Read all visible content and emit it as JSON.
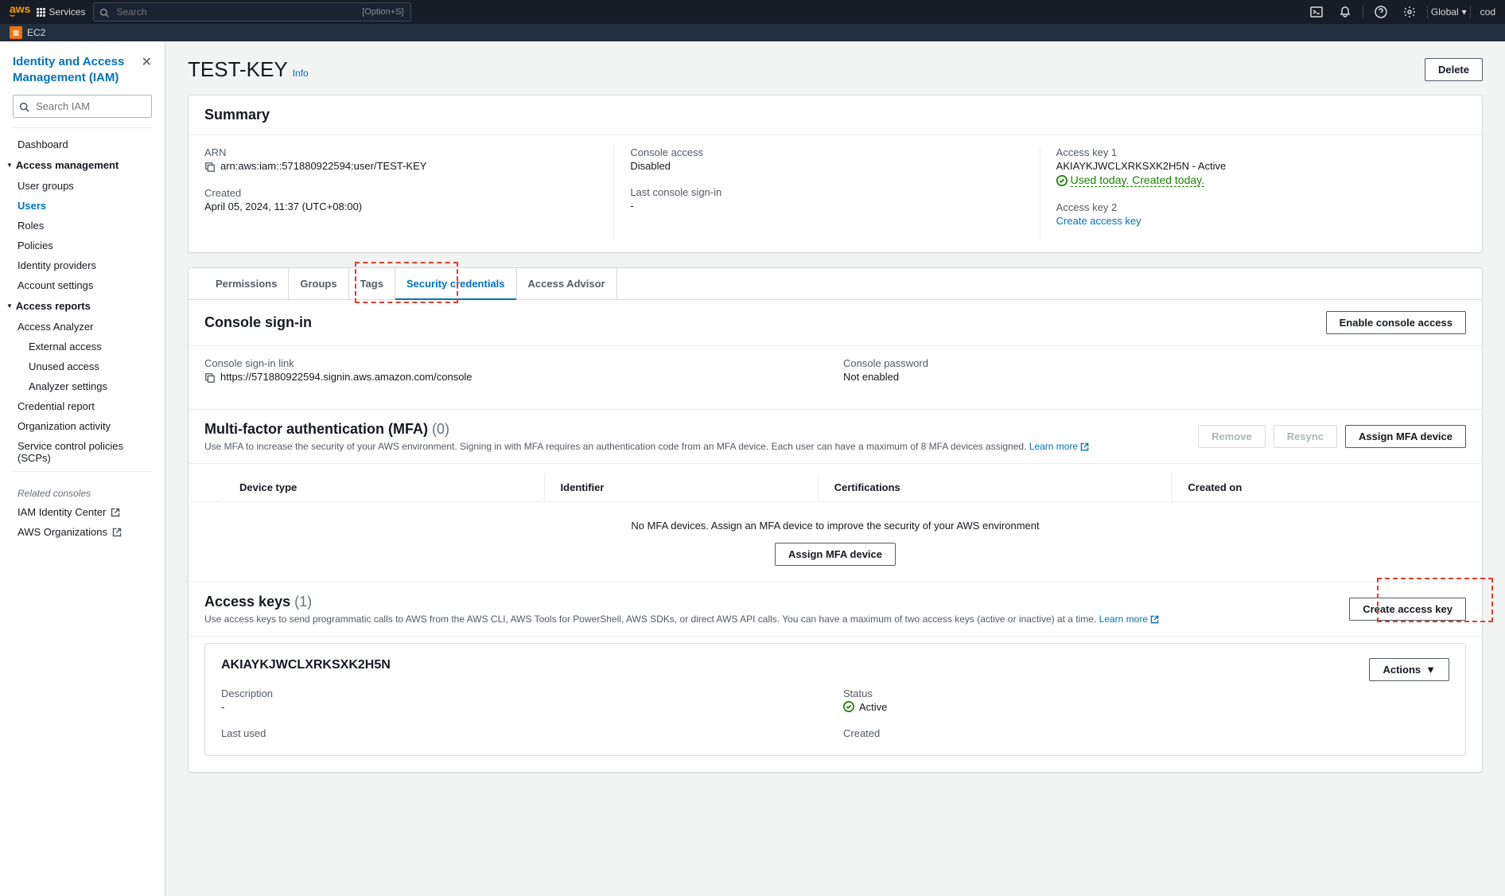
{
  "topnav": {
    "services_label": "Services",
    "search_placeholder": "Search",
    "search_kbd": "[Option+S]",
    "region": "Global",
    "account_fragment": "cod"
  },
  "servicenav": {
    "ec2": "EC2"
  },
  "sidebar": {
    "title": "Identity and Access Management (IAM)",
    "search_placeholder": "Search IAM",
    "dashboard": "Dashboard",
    "section_access_mgmt": "Access management",
    "user_groups": "User groups",
    "users": "Users",
    "roles": "Roles",
    "policies": "Policies",
    "identity_providers": "Identity providers",
    "account_settings": "Account settings",
    "section_access_reports": "Access reports",
    "access_analyzer": "Access Analyzer",
    "external_access": "External access",
    "unused_access": "Unused access",
    "analyzer_settings": "Analyzer settings",
    "credential_report": "Credential report",
    "organization_activity": "Organization activity",
    "scps": "Service control policies (SCPs)",
    "related_header": "Related consoles",
    "iam_identity_center": "IAM Identity Center",
    "aws_organizations": "AWS Organizations"
  },
  "page": {
    "title": "TEST-KEY",
    "info": "Info",
    "delete_btn": "Delete"
  },
  "summary": {
    "header": "Summary",
    "arn_label": "ARN",
    "arn_value": "arn:aws:iam::571880922594:user/TEST-KEY",
    "created_label": "Created",
    "created_value": "April 05, 2024, 11:37 (UTC+08:00)",
    "console_access_label": "Console access",
    "console_access_value": "Disabled",
    "last_signin_label": "Last console sign-in",
    "last_signin_value": "-",
    "key1_label": "Access key 1",
    "key1_value": "AKIAYKJWCLXRKSXK2H5N - Active",
    "key1_status": "Used today. Created today.",
    "key2_label": "Access key 2",
    "key2_link": "Create access key"
  },
  "tabs": {
    "permissions": "Permissions",
    "groups": "Groups",
    "tags": "Tags",
    "security": "Security credentials",
    "advisor": "Access Advisor"
  },
  "console_signin": {
    "header": "Console sign-in",
    "enable_btn": "Enable console access",
    "link_label": "Console sign-in link",
    "link_value": "https://571880922594.signin.aws.amazon.com/console",
    "pwd_label": "Console password",
    "pwd_value": "Not enabled"
  },
  "mfa": {
    "header": "Multi-factor authentication (MFA)",
    "count": "(0)",
    "desc": "Use MFA to increase the security of your AWS environment. Signing in with MFA requires an authentication code from an MFA device. Each user can have a maximum of 8 MFA devices assigned.",
    "learn_more": "Learn more",
    "remove_btn": "Remove",
    "resync_btn": "Resync",
    "assign_btn": "Assign MFA device",
    "col_device": "Device type",
    "col_identifier": "Identifier",
    "col_certs": "Certifications",
    "col_created": "Created on",
    "empty_text": "No MFA devices. Assign an MFA device to improve the security of your AWS environment",
    "empty_btn": "Assign MFA device"
  },
  "access_keys": {
    "header": "Access keys",
    "count": "(1)",
    "desc": "Use access keys to send programmatic calls to AWS from the AWS CLI, AWS Tools for PowerShell, AWS SDKs, or direct AWS API calls. You can have a maximum of two access keys (active or inactive) at a time.",
    "learn_more": "Learn more",
    "create_btn": "Create access key",
    "key_id": "AKIAYKJWCLXRKSXK2H5N",
    "actions_btn": "Actions",
    "desc_label": "Description",
    "desc_value": "-",
    "status_label": "Status",
    "status_value": "Active",
    "last_used_label": "Last used",
    "created_label": "Created"
  }
}
